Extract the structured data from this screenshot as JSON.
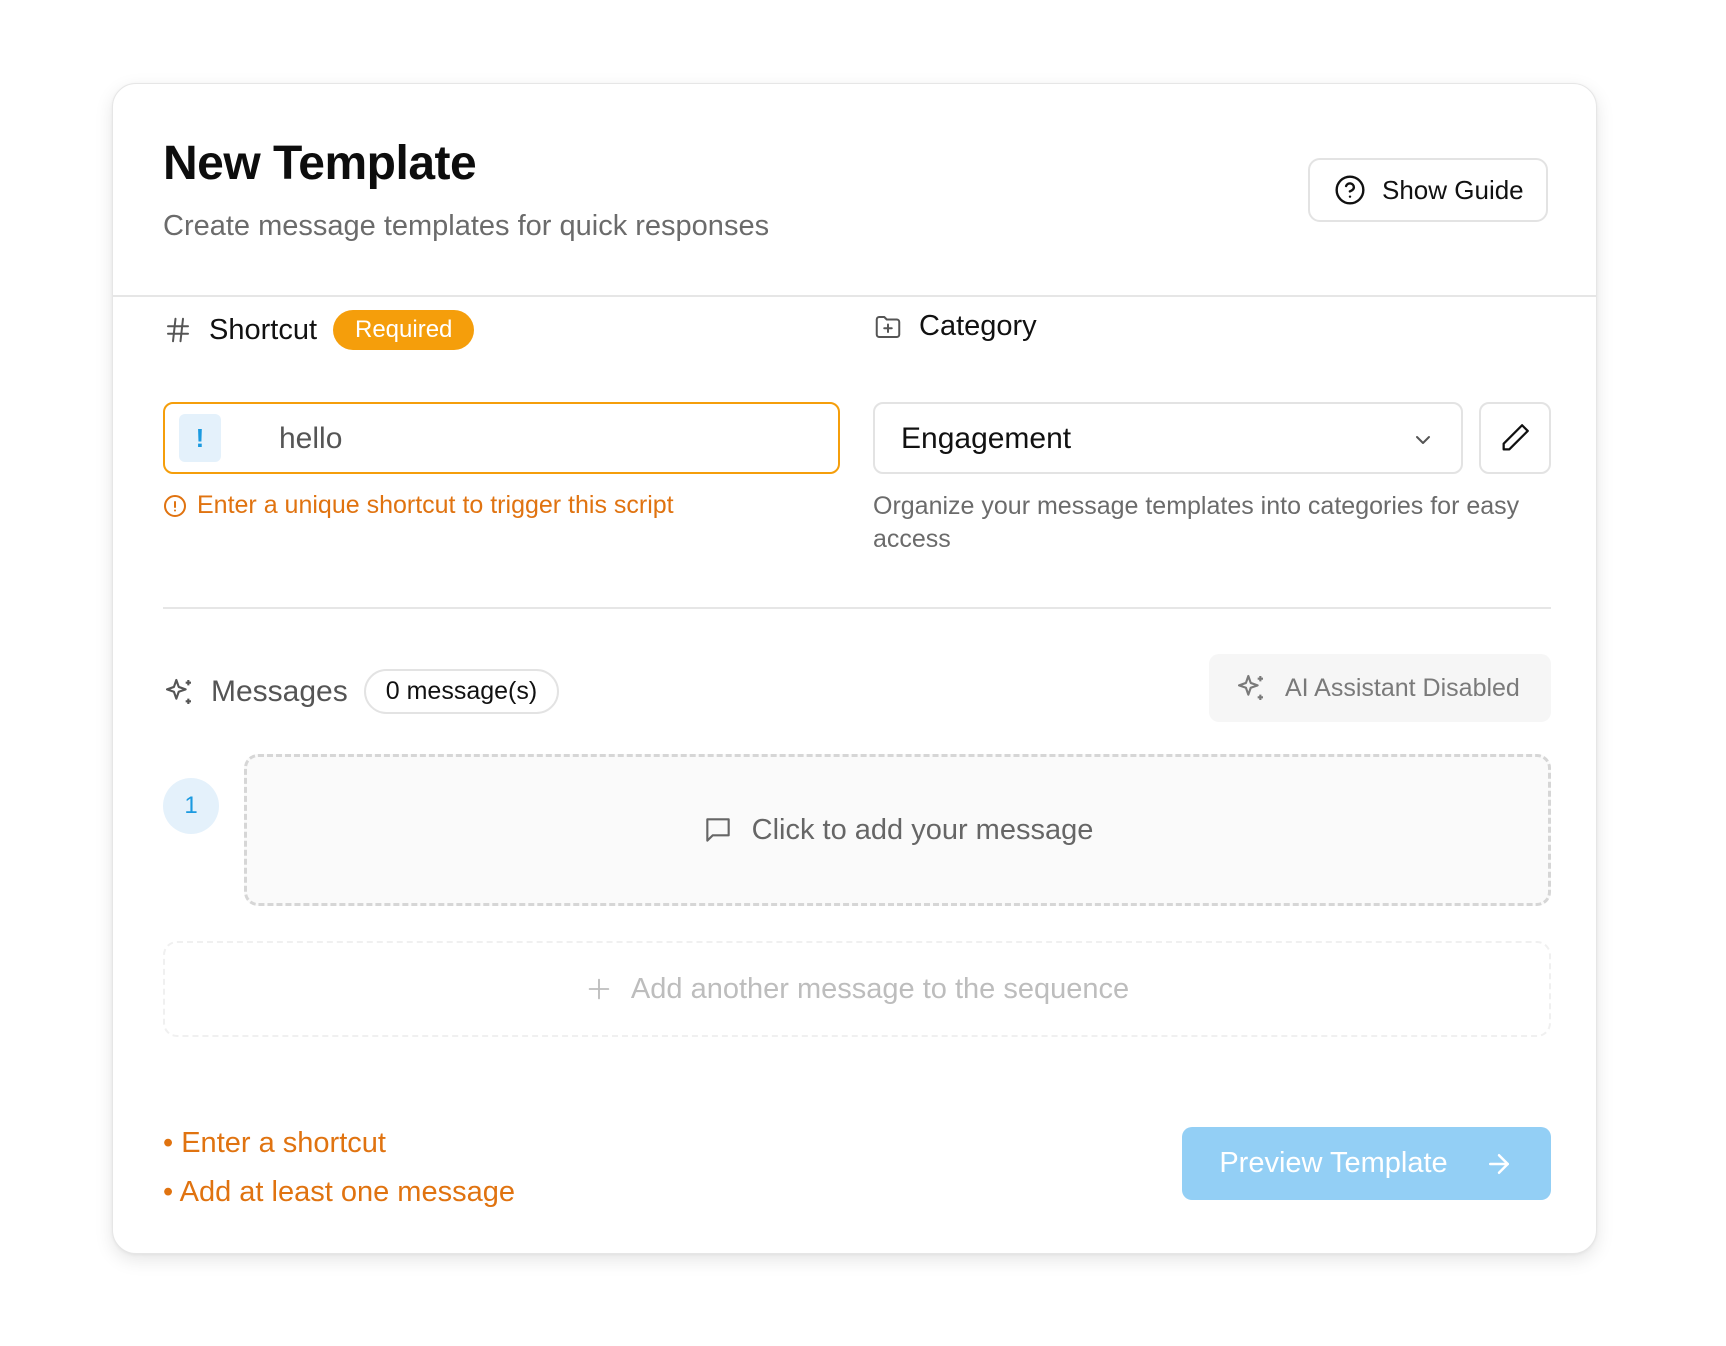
{
  "header": {
    "title": "New Template",
    "subtitle": "Create message templates for quick responses",
    "guide_button": "Show Guide"
  },
  "shortcut": {
    "label": "Shortcut",
    "required_badge": "Required",
    "prefix": "!",
    "value": "hello",
    "error_hint": "Enter a unique shortcut to trigger this script"
  },
  "category": {
    "label": "Category",
    "selected": "Engagement",
    "help": "Organize your message templates into categories for easy access"
  },
  "messages": {
    "label": "Messages",
    "count": "0 message(s)",
    "ai_button": "AI Assistant Disabled",
    "step_number": "1",
    "placeholder": "Click to add your message",
    "add_another": "Add another message to the sequence"
  },
  "validation": [
    "Enter a shortcut",
    "Add at least one message"
  ],
  "footer": {
    "preview_button": "Preview Template"
  },
  "colors": {
    "accent_orange": "#f59e0b",
    "error_text": "#e07310",
    "primary_disabled": "#93cff5",
    "info_blue": "#1b9ae0"
  },
  "icons": {
    "guide": "help-circle-icon",
    "shortcut": "hash-icon",
    "category": "folder-plus-icon",
    "dropdown": "chevron-down-icon",
    "edit": "pencil-icon",
    "error": "info-circle-icon",
    "messages": "sparkles-icon",
    "ai": "sparkles-icon",
    "message": "message-square-icon",
    "add": "plus-icon",
    "preview": "arrow-right-icon"
  }
}
